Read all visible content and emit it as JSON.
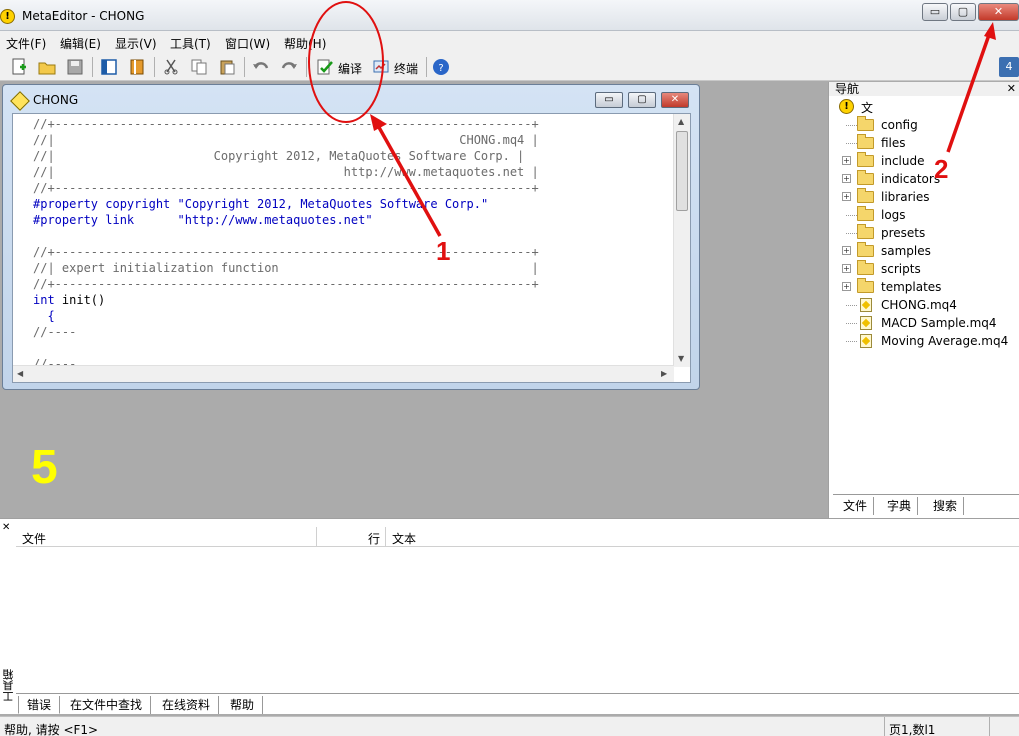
{
  "window": {
    "title": "MetaEditor - CHONG",
    "app_icon_glyph": "!",
    "min_glyph": "▭",
    "max_glyph": "▢",
    "close_glyph": "✕"
  },
  "menu": [
    "文件(F)",
    "编辑(E)",
    "显示(V)",
    "工具(T)",
    "窗口(W)",
    "帮助(H)"
  ],
  "toolbar": {
    "compile_label": "编译",
    "terminal_label": "终端",
    "badge": "4"
  },
  "editor": {
    "title": "CHONG",
    "lines": [
      {
        "text": "//+------------------------------------------------------------------+",
        "kind": "comment"
      },
      {
        "text": "//|                                                        CHONG.mq4 |",
        "kind": "comment"
      },
      {
        "text": "//|                      Copyright 2012, MetaQuotes Software Corp. |",
        "kind": "comment"
      },
      {
        "text": "//|                                        http://www.metaquotes.net |",
        "kind": "comment"
      },
      {
        "text": "//+------------------------------------------------------------------+",
        "kind": "comment"
      },
      {
        "kw": "#property copyright",
        "str": " \"Copyright 2012, MetaQuotes Software Corp.\"",
        "kind": "prop"
      },
      {
        "kw": "#property link",
        "str": "      \"http://www.metaquotes.net\"",
        "kind": "prop"
      },
      {
        "text": "",
        "kind": "plain"
      },
      {
        "text": "//+------------------------------------------------------------------+",
        "kind": "comment"
      },
      {
        "text": "//| expert initialization function                                   |",
        "kind": "comment"
      },
      {
        "text": "//+------------------------------------------------------------------+",
        "kind": "comment"
      },
      {
        "kw": "int",
        "str": " init()",
        "kind": "func"
      },
      {
        "text": "  {",
        "kind": "brace"
      },
      {
        "text": "//----",
        "kind": "comment"
      },
      {
        "text": "",
        "kind": "plain"
      },
      {
        "text": "//----",
        "kind": "comment"
      }
    ]
  },
  "navigator": {
    "title": "导航",
    "root": "文件",
    "items": [
      {
        "label": "config",
        "type": "folder",
        "expandable": false
      },
      {
        "label": "files",
        "type": "folder",
        "expandable": false
      },
      {
        "label": "include",
        "type": "folder",
        "expandable": true
      },
      {
        "label": "indicators",
        "type": "folder",
        "expandable": true
      },
      {
        "label": "libraries",
        "type": "folder",
        "expandable": true
      },
      {
        "label": "logs",
        "type": "folder",
        "expandable": false
      },
      {
        "label": "presets",
        "type": "folder",
        "expandable": false
      },
      {
        "label": "samples",
        "type": "folder",
        "expandable": true
      },
      {
        "label": "scripts",
        "type": "folder",
        "expandable": true
      },
      {
        "label": "templates",
        "type": "folder",
        "expandable": true
      },
      {
        "label": "CHONG.mq4",
        "type": "file",
        "expandable": false
      },
      {
        "label": "MACD Sample.mq4",
        "type": "file",
        "expandable": false
      },
      {
        "label": "Moving Average.mq4",
        "type": "file",
        "expandable": false
      }
    ],
    "tabs": [
      "文件",
      "字典",
      "搜索"
    ]
  },
  "toolbox": {
    "vertical_label": "工具箱",
    "columns": [
      "文件",
      "行",
      "文本"
    ],
    "tabs": [
      "错误",
      "在文件中查找",
      "在线资料",
      "帮助"
    ]
  },
  "status": {
    "left": "帮助, 请按 <F1>",
    "right": "页1,数l1"
  },
  "annotations": {
    "numbers": [
      "1",
      "2",
      "5"
    ],
    "color": "#e01010",
    "big_number_color": "#ffff00"
  }
}
